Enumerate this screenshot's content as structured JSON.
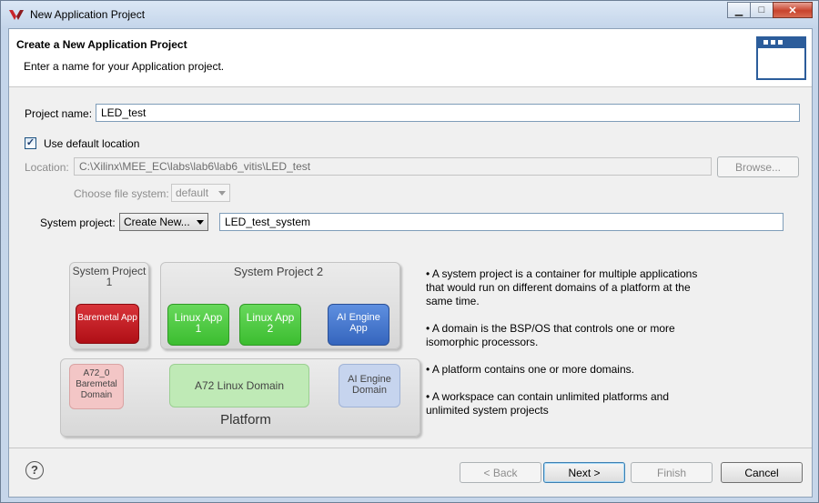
{
  "window": {
    "title": "New Application Project",
    "controls": {
      "minimize": "▁",
      "maximize": "□",
      "close": "✕"
    }
  },
  "header": {
    "title": "Create a New Application Project",
    "description": "Enter a name for your Application project."
  },
  "form": {
    "project_name_label": "Project name:",
    "project_name_value": "LED_test",
    "use_default_location_label": "Use default location",
    "use_default_location_checked": true,
    "location_label": "Location:",
    "location_value": "C:\\Xilinx\\MEE_EC\\labs\\lab6\\lab6_vitis\\LED_test",
    "browse_label": "Browse...",
    "file_system_label": "Choose file system:",
    "file_system_value": "default",
    "system_project_label": "System project:",
    "system_project_select": "Create New...",
    "system_project_name": "LED_test_system"
  },
  "diagram": {
    "system_project_1": "System Project 1",
    "system_project_2": "System Project 2",
    "baremetal_app": "Baremetal App",
    "linux_app_1": "Linux App 1",
    "linux_app_2": "Linux App 2",
    "ai_engine_app": "AI Engine App",
    "a72_baremetal_domain": "A72_0 Baremetal Domain",
    "a72_linux_domain": "A72 Linux Domain",
    "ai_engine_domain": "AI Engine Domain",
    "platform": "Platform"
  },
  "info_bullets": [
    "• A system project is a container for multiple applications that would run on different domains of a platform at the same time.",
    "• A domain is the BSP/OS that controls one or more isomorphic processors.",
    "• A platform contains one or more domains.",
    "• A workspace can contain unlimited platforms and unlimited system projects"
  ],
  "footer": {
    "help": "?",
    "back": "< Back",
    "next": "Next >",
    "finish": "Finish",
    "cancel": "Cancel"
  },
  "colors": {
    "baremetal_app": "#c8171e",
    "linux_app": "#46c83a",
    "ai_engine_app": "#3f72c8",
    "baremetal_domain": "#f3c6c6",
    "linux_domain": "#bfeab6",
    "ai_engine_domain": "#c6d4ee"
  }
}
